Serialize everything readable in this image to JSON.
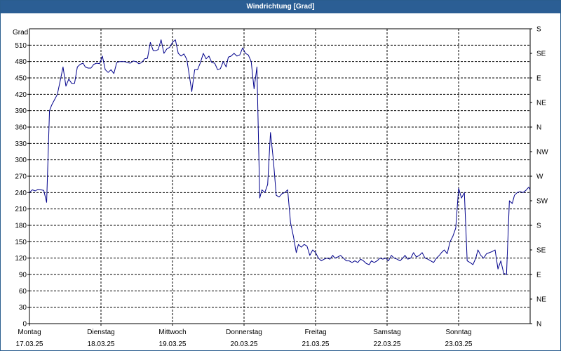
{
  "window": {
    "title": "Windrichtung [Grad]"
  },
  "chart_data": {
    "type": "line",
    "title": "Windrichtung [Grad]",
    "ylabel": "Grad",
    "ylim": [
      0,
      540
    ],
    "y_ticks": [
      0,
      30,
      60,
      90,
      120,
      150,
      180,
      210,
      240,
      270,
      300,
      330,
      360,
      390,
      420,
      450,
      480,
      510
    ],
    "y_tick_labels": [
      "0",
      "30",
      "60",
      "90",
      "120",
      "150",
      "180",
      "210",
      "240",
      "270",
      "300",
      "330",
      "360",
      "390",
      "420",
      "450",
      "480",
      "510"
    ],
    "right_axis_labels": [
      {
        "value": 0,
        "label": "N"
      },
      {
        "value": 45,
        "label": "NE"
      },
      {
        "value": 90,
        "label": "E"
      },
      {
        "value": 135,
        "label": "SE"
      },
      {
        "value": 180,
        "label": "S"
      },
      {
        "value": 225,
        "label": "SW"
      },
      {
        "value": 270,
        "label": "W"
      },
      {
        "value": 315,
        "label": "NW"
      },
      {
        "value": 360,
        "label": "N"
      },
      {
        "value": 405,
        "label": "NE"
      },
      {
        "value": 450,
        "label": "E"
      },
      {
        "value": 495,
        "label": "SE"
      },
      {
        "value": 540,
        "label": "S"
      }
    ],
    "xlim": [
      0,
      7
    ],
    "x_ticks": [
      {
        "day": 0,
        "weekday": "Montag",
        "date": "17.03.25"
      },
      {
        "day": 1,
        "weekday": "Dienstag",
        "date": "18.03.25"
      },
      {
        "day": 2,
        "weekday": "Mittwoch",
        "date": "19.03.25"
      },
      {
        "day": 3,
        "weekday": "Donnerstag",
        "date": "20.03.25"
      },
      {
        "day": 4,
        "weekday": "Freitag",
        "date": "21.03.25"
      },
      {
        "day": 5,
        "weekday": "Samstag",
        "date": "22.03.25"
      },
      {
        "day": 6,
        "weekday": "Sonntag",
        "date": "23.03.25"
      }
    ],
    "grid": true,
    "line_color": "#00008b",
    "series": [
      {
        "x": [
          0.0,
          0.04,
          0.08,
          0.12,
          0.16,
          0.2,
          0.24,
          0.28,
          0.31,
          0.35,
          0.39,
          0.43,
          0.47,
          0.51,
          0.55,
          0.59,
          0.63,
          0.67,
          0.71,
          0.75,
          0.78,
          0.82,
          0.86,
          0.9,
          0.94,
          0.98,
          1.02,
          1.06,
          1.1,
          1.14,
          1.18,
          1.22,
          1.26,
          1.3,
          1.33,
          1.37,
          1.41,
          1.45,
          1.49,
          1.53,
          1.57,
          1.61,
          1.65,
          1.69,
          1.73,
          1.77,
          1.8,
          1.84,
          1.88,
          1.92,
          1.96,
          2.0,
          2.04,
          2.08,
          2.12,
          2.16,
          2.2,
          2.24,
          2.27,
          2.31,
          2.35,
          2.39,
          2.43,
          2.47,
          2.51,
          2.55,
          2.59,
          2.63,
          2.67,
          2.71,
          2.75,
          2.78,
          2.82,
          2.86,
          2.9,
          2.94,
          2.98,
          3.02,
          3.06,
          3.1,
          3.14,
          3.18,
          3.22,
          3.25,
          3.29,
          3.33,
          3.37,
          3.41,
          3.45,
          3.49,
          3.53,
          3.57,
          3.61,
          3.65,
          3.69,
          3.73,
          3.76,
          3.8,
          3.84,
          3.88,
          3.92,
          3.96,
          4.0,
          4.04,
          4.08,
          4.12,
          4.16,
          4.2,
          4.24,
          4.27,
          4.31,
          4.35,
          4.39,
          4.43,
          4.47,
          4.51,
          4.55,
          4.59,
          4.63,
          4.67,
          4.71,
          4.75,
          4.78,
          4.82,
          4.86,
          4.9,
          4.94,
          4.98,
          5.02,
          5.06,
          5.1,
          5.14,
          5.18,
          5.22,
          5.25,
          5.29,
          5.33,
          5.37,
          5.41,
          5.45,
          5.49,
          5.53,
          5.57,
          5.61,
          5.65,
          5.69,
          5.73,
          5.76,
          5.8,
          5.84,
          5.88,
          5.92,
          5.96,
          6.0,
          6.04,
          6.08,
          6.12,
          6.16,
          6.2,
          6.24,
          6.27,
          6.31,
          6.35,
          6.39,
          6.43,
          6.47,
          6.51,
          6.55,
          6.59,
          6.63,
          6.67,
          6.71,
          6.75,
          6.78,
          6.82,
          6.86,
          6.9,
          6.94,
          6.98,
          7.0
        ],
        "values": [
          240,
          245,
          243,
          246,
          245,
          244,
          222,
          390,
          400,
          410,
          420,
          445,
          470,
          435,
          448,
          440,
          440,
          470,
          475,
          477,
          470,
          468,
          468,
          475,
          477,
          476,
          490,
          465,
          460,
          465,
          458,
          478,
          480,
          480,
          480,
          478,
          477,
          481,
          480,
          476,
          478,
          485,
          486,
          515,
          500,
          500,
          502,
          520,
          495,
          503,
          506,
          515,
          520,
          495,
          490,
          494,
          484,
          450,
          425,
          465,
          465,
          478,
          495,
          485,
          490,
          478,
          477,
          465,
          467,
          480,
          470,
          488,
          490,
          495,
          490,
          492,
          505,
          495,
          492,
          480,
          430,
          470,
          230,
          245,
          240,
          255,
          350,
          300,
          235,
          232,
          238,
          240,
          245,
          185,
          160,
          130,
          145,
          140,
          145,
          142,
          125,
          135,
          130,
          120,
          115,
          118,
          120,
          118,
          125,
          120,
          122,
          125,
          120,
          115,
          115,
          112,
          115,
          112,
          118,
          115,
          110,
          108,
          115,
          112,
          115,
          120,
          118,
          120,
          115,
          125,
          120,
          118,
          115,
          120,
          125,
          118,
          120,
          130,
          122,
          125,
          130,
          120,
          118,
          115,
          112,
          120,
          125,
          130,
          135,
          128,
          150,
          160,
          175,
          248,
          230,
          240,
          115,
          112,
          108,
          120,
          135,
          125,
          120,
          128,
          130,
          132,
          135,
          100,
          115,
          92,
          90,
          225,
          220,
          235,
          240,
          242,
          240,
          244,
          250,
          245
        ]
      }
    ]
  }
}
